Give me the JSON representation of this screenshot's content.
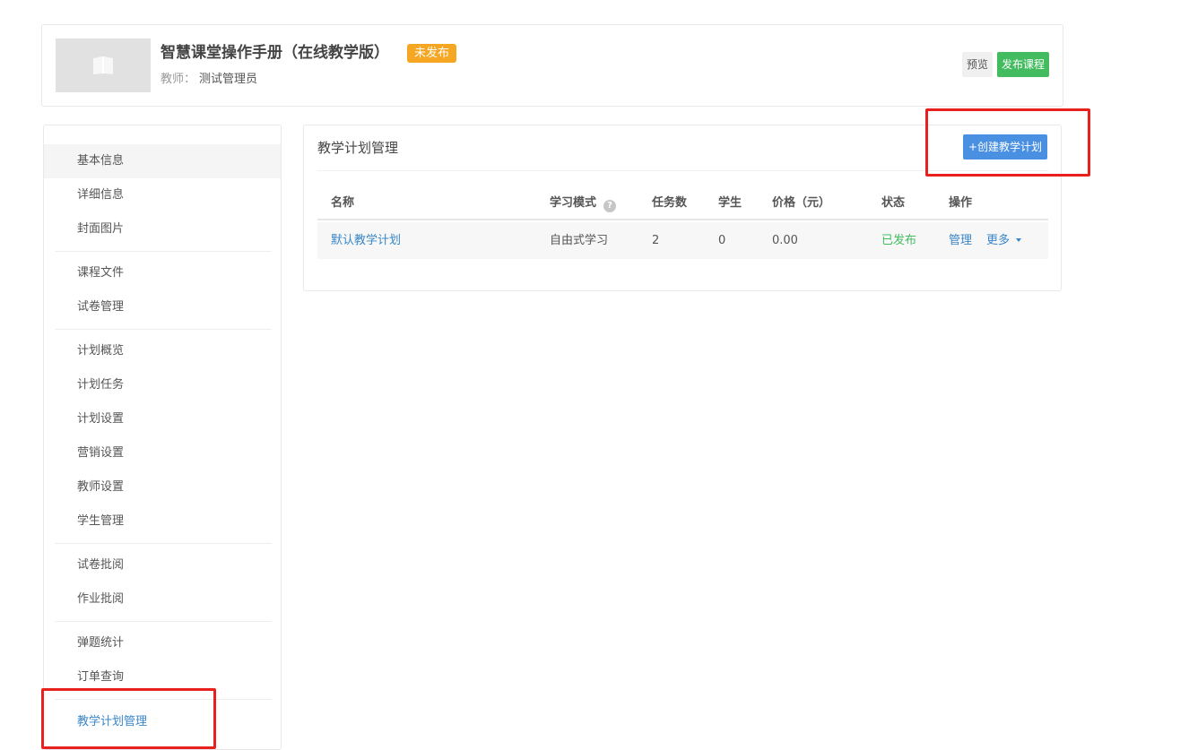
{
  "course": {
    "title": "智慧课堂操作手册（在线教学版）",
    "status_badge": "未发布",
    "teacher_label": "教师：",
    "teacher_name": "测试管理员",
    "preview_label": "预览",
    "publish_label": "发布课程"
  },
  "sidebar": {
    "items": [
      {
        "label": "基本信息"
      },
      {
        "label": "详细信息"
      },
      {
        "label": "封面图片"
      },
      {
        "label": "课程文件"
      },
      {
        "label": "试卷管理"
      },
      {
        "label": "计划概览"
      },
      {
        "label": "计划任务"
      },
      {
        "label": "计划设置"
      },
      {
        "label": "营销设置"
      },
      {
        "label": "教师设置"
      },
      {
        "label": "学生管理"
      },
      {
        "label": "试卷批阅"
      },
      {
        "label": "作业批阅"
      },
      {
        "label": "弹题统计"
      },
      {
        "label": "订单查询"
      },
      {
        "label": "教学计划管理"
      }
    ]
  },
  "main": {
    "title": "教学计划管理",
    "create_button": "+创建教学计划",
    "table": {
      "columns": [
        "名称",
        "学习模式",
        "任务数",
        "学生",
        "价格（元）",
        "状态",
        "操作"
      ],
      "rows": [
        {
          "name": "默认教学计划",
          "mode": "自由式学习",
          "tasks": "2",
          "students": "0",
          "price": "0.00",
          "status": "已发布",
          "action_manage": "管理",
          "action_more": "更多"
        }
      ]
    }
  },
  "colors": {
    "accent": "#4a90e2",
    "success": "#43bc60",
    "warning": "#f5a623",
    "link": "#3a86c8",
    "highlight": "#e8201e"
  }
}
